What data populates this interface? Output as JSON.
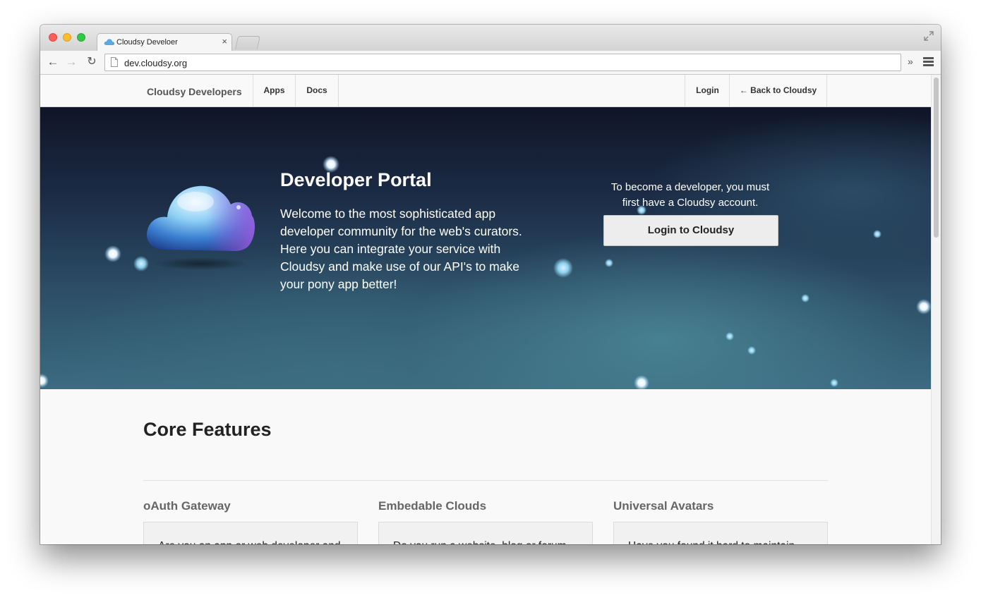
{
  "browser": {
    "tab_title": "Cloudsy Develoer",
    "tab_close": "×",
    "url": "dev.cloudsy.org",
    "more_chevrons": "»",
    "back_glyph": "←",
    "forward_glyph": "→",
    "reload_glyph": "↻"
  },
  "site_nav": {
    "brand": "Cloudsy Developers",
    "links": [
      "Apps",
      "Docs"
    ],
    "right_links": [
      "Login",
      "← Back to Cloudsy"
    ]
  },
  "hero": {
    "title": "Developer Portal",
    "body": "Welcome to the most sophisticated app developer community for the web's curators. Here you can integrate your service with Cloudsy and make use of our API's to make your pony app better!",
    "signup_note": "To become a developer, you must first have a Cloudsy account.",
    "login_button": "Login to Cloudsy",
    "accent_colors": [
      "#101527",
      "#3c6b82",
      "#9a5ee0"
    ]
  },
  "features": {
    "title": "Core Features",
    "items": [
      {
        "title": "oAuth Gateway",
        "text": "Are you an app or web developer and want to get started quickly"
      },
      {
        "title": "Embedable Clouds",
        "text": "Do you run a website, blog or forum where you want your users to"
      },
      {
        "title": "Universal Avatars",
        "text": "Have you found it hard to maintain avatar uploads, storage and"
      }
    ]
  },
  "icons": [
    "traffic-light-close",
    "traffic-light-minimize",
    "traffic-light-zoom",
    "cloud-favicon",
    "fullscreen-icon",
    "back-arrow-icon",
    "forward-arrow-icon",
    "reload-icon",
    "page-icon",
    "hamburger-menu-icon",
    "cloud-logo"
  ]
}
